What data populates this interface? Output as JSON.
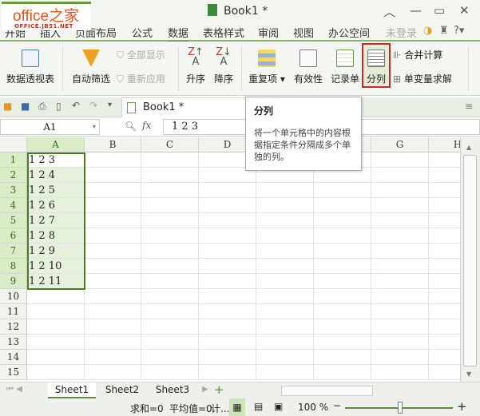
{
  "window": {
    "title": "Book1 *"
  },
  "logo": {
    "text": "office之家",
    "sub": "OFFICE.JB51.NET"
  },
  "menu": {
    "items": [
      "开始",
      "插入",
      "页面布局",
      "公式",
      "数据",
      "表格样式",
      "审阅",
      "视图",
      "办公空间"
    ],
    "active": "数据",
    "login": "未登录"
  },
  "ribbon": {
    "pivot": "数据透视表",
    "autofilter": "自动筛选",
    "show_all": "全部显示",
    "reapply": "重新应用",
    "sort_asc": "升序",
    "sort_desc": "降序",
    "duplicates": "重复项",
    "validity": "有效性",
    "record": "记录单",
    "split": "分列",
    "consolidate": "合并计算",
    "what_if": "单变量求解"
  },
  "quickbar": {
    "doc_tab": "Book1 *"
  },
  "formula_bar": {
    "name_box": "A1",
    "fx": "fx",
    "value": "1 2 3"
  },
  "tooltip": {
    "title": "分列",
    "description": "将一个单元格中的内容根据指定条件分隔成多个单独的列。"
  },
  "grid": {
    "columns": [
      "A",
      "B",
      "C",
      "D",
      "E",
      "F",
      "G",
      "H"
    ],
    "rows": [
      "1",
      "2",
      "3",
      "4",
      "5",
      "6",
      "7",
      "8",
      "9",
      "10",
      "11",
      "12",
      "13",
      "14",
      "15"
    ],
    "column_a": [
      "1 2 3",
      "1 2 4",
      "1 2 5",
      "1 2 6",
      "1 2 7",
      "1 2 8",
      "1 2 9",
      "1 2 10",
      "1 2 11"
    ]
  },
  "sheets": {
    "tabs": [
      "Sheet1",
      "Sheet2",
      "Sheet3"
    ],
    "active": "Sheet1"
  },
  "status": {
    "sum": "求和=0",
    "avg": "平均值=0",
    "count": "计...",
    "zoom": "100 %",
    "zoom_level": 50
  },
  "colors": {
    "accent": "#5a8a3a",
    "highlight": "#c8282a"
  }
}
